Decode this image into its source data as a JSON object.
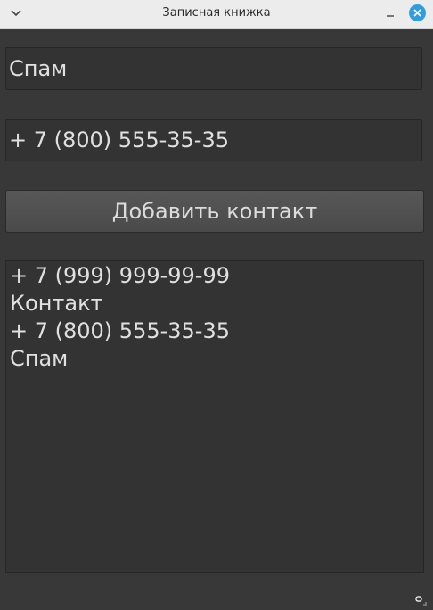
{
  "window": {
    "title": "Записная книжка"
  },
  "form": {
    "name_value": "Спам",
    "phone_value": "+ 7 (800) 555-35-35",
    "add_button_label": "Добавить контакт"
  },
  "contacts": {
    "items": [
      "+ 7 (999) 999-99-99",
      "Контакт",
      "+ 7 (800) 555-35-35",
      "Спам"
    ]
  },
  "colors": {
    "close_button": "#2f9ee0",
    "background": "#383838",
    "field_background": "#333333",
    "text": "#e0e0e0"
  },
  "icons": {
    "menu": "chevron-down-icon",
    "minimize": "minimize-icon",
    "close": "close-icon",
    "resize": "resize-grip-icon"
  }
}
